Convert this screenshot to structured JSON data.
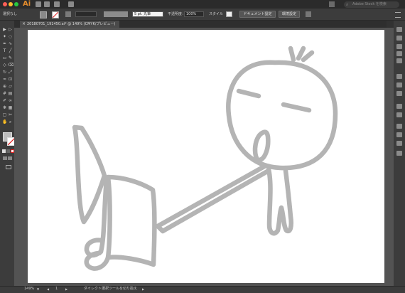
{
  "app": {
    "logo": "Ai",
    "search_placeholder": "Adobe Stock を検索"
  },
  "control_bar": {
    "selection_label": "選択なし",
    "stroke_weight_value": "",
    "brush_label": "5 pt. 丸筆",
    "opacity_label": "不透明度：",
    "opacity_value": "100%",
    "style_label": "スタイル",
    "doc_setup_button": "ドキュメント設定",
    "prefs_button": "環境設定"
  },
  "document_tab": {
    "close_glyph": "×",
    "title": "20180701_191450.ai* @ 149% (CMYK/プレビュー)"
  },
  "status_bar": {
    "zoom": "149%",
    "artboard_number": "1",
    "tool_hint": "ダイレクト選択ツールを切り換え"
  },
  "colors": {
    "ai_brand": "#e08a2c",
    "stroke_gray": "#b4b4b4",
    "close": "#ff5f57",
    "minimize": "#febc2e",
    "zoom": "#28c840"
  },
  "icons": {
    "toolbar": [
      "selection-tool",
      "direct-selection-tool",
      "magic-wand-tool",
      "lasso-tool",
      "pen-tool",
      "curvature-tool",
      "type-tool",
      "line-tool",
      "rectangle-tool",
      "paintbrush-tool",
      "shaper-tool",
      "eraser-tool",
      "rotate-tool",
      "scale-tool",
      "warp-tool",
      "free-transform-tool",
      "shape-builder-tool",
      "perspective-tool",
      "mesh-tool",
      "gradient-tool",
      "eyedropper-tool",
      "blend-tool",
      "symbol-sprayer-tool",
      "column-graph-tool",
      "artboard-tool",
      "slice-tool",
      "hand-tool",
      "zoom-tool"
    ]
  }
}
